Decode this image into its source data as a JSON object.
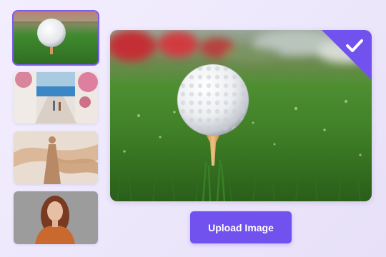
{
  "thumbnails": [
    {
      "subject": "golf-ball-thumbnail",
      "selected": true
    },
    {
      "subject": "seaside-street-thumbnail",
      "selected": false
    },
    {
      "subject": "woman-flowing-scarf-thumbnail",
      "selected": false
    },
    {
      "subject": "woman-portrait-thumbnail",
      "selected": false
    }
  ],
  "preview": {
    "subject": "golf-ball-on-tee-photo",
    "selected_icon": "check-icon"
  },
  "upload_button": {
    "label": "Upload Image"
  },
  "colors": {
    "accent": "#7152ee",
    "selected_outline": "#7a5cf0",
    "background": "#efe9fc"
  }
}
